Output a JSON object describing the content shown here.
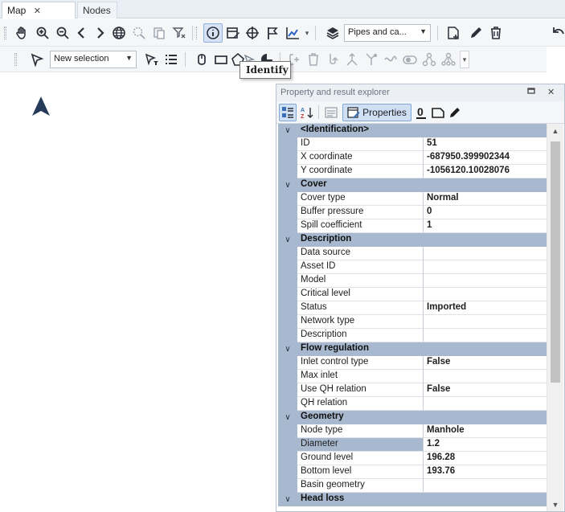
{
  "tabs": [
    {
      "label": "Map",
      "close": "✕"
    },
    {
      "label": "Nodes"
    }
  ],
  "toolbar1": {
    "layer_combo": "Pipes and ca...",
    "icons": [
      "pan-icon",
      "zoom-in-icon",
      "zoom-out-icon",
      "back-icon",
      "forward-icon",
      "globe-icon",
      "zoom-selection-icon",
      "copy-icon",
      "clear-filter-icon",
      "identify-icon",
      "edit-properties-icon",
      "graticule-icon",
      "flag-icon",
      "chart-icon",
      "layers-icon",
      "new-icon",
      "pencil-icon",
      "delete-icon"
    ]
  },
  "toolbar2": {
    "selection_combo": "New selection",
    "icons": [
      "select-icon",
      "filter-select-icon",
      "list-icon",
      "lasso-icon",
      "rectangle-icon",
      "polygon-icon",
      "cursor-icon",
      "circle-icon"
    ]
  },
  "tooltip": "Identify",
  "panel": {
    "title": "Property and result explorer",
    "properties_button": "Properties",
    "categories": [
      {
        "name": "<Identification>",
        "rows": [
          {
            "name": "ID",
            "value": "51"
          },
          {
            "name": "X coordinate",
            "value": "-687950.399902344"
          },
          {
            "name": "Y coordinate",
            "value": "-1056120.10028076"
          }
        ]
      },
      {
        "name": "Cover",
        "rows": [
          {
            "name": "Cover type",
            "value": "Normal"
          },
          {
            "name": "Buffer pressure",
            "value": "0"
          },
          {
            "name": "Spill coefficient",
            "value": "1"
          }
        ]
      },
      {
        "name": "Description",
        "rows": [
          {
            "name": "Data source",
            "value": ""
          },
          {
            "name": "Asset ID",
            "value": ""
          },
          {
            "name": "Model",
            "value": ""
          },
          {
            "name": "Critical level",
            "value": ""
          },
          {
            "name": "Status",
            "value": "Imported"
          },
          {
            "name": "Network type",
            "value": ""
          },
          {
            "name": "Description",
            "value": ""
          }
        ]
      },
      {
        "name": "Flow regulation",
        "rows": [
          {
            "name": "Inlet control type",
            "value": "False"
          },
          {
            "name": "Max inlet",
            "value": ""
          },
          {
            "name": "Use QH relation",
            "value": "False"
          },
          {
            "name": "QH relation",
            "value": ""
          }
        ]
      },
      {
        "name": "Geometry",
        "rows": [
          {
            "name": "Node type",
            "value": "Manhole"
          },
          {
            "name": "Diameter",
            "value": "1.2",
            "selected": true
          },
          {
            "name": "Ground level",
            "value": "196.28"
          },
          {
            "name": "Bottom level",
            "value": "193.76"
          },
          {
            "name": "Basin geometry",
            "value": ""
          }
        ]
      },
      {
        "name": "Head loss",
        "rows": []
      }
    ]
  }
}
